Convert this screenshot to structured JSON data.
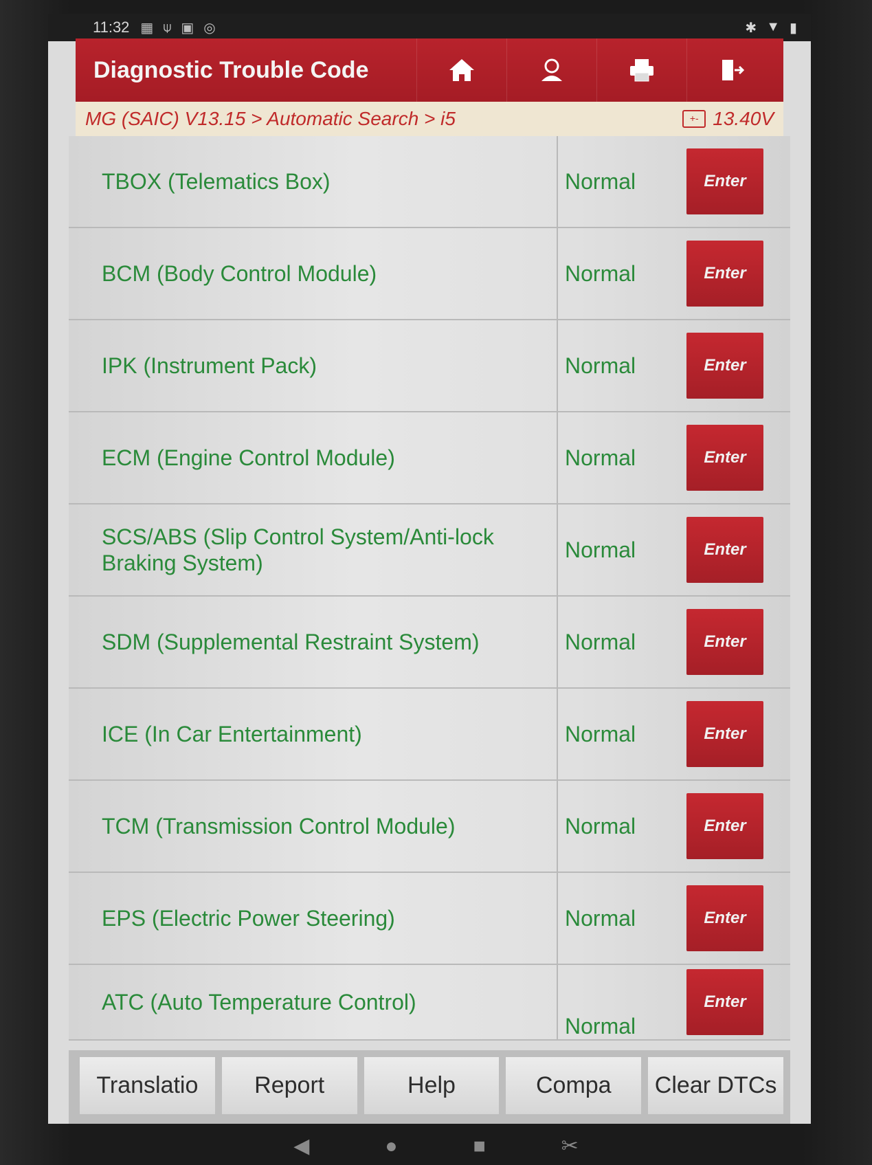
{
  "status_bar": {
    "time": "11:32",
    "icons": [
      "notification-icon",
      "usb-icon",
      "image-icon",
      "sync-icon"
    ],
    "right_icons": [
      "bluetooth-icon",
      "wifi-icon",
      "battery-icon"
    ]
  },
  "header": {
    "title": "Diagnostic Trouble Code",
    "buttons": [
      "home-icon",
      "user-icon",
      "print-icon",
      "exit-icon"
    ]
  },
  "breadcrumb": {
    "path": "MG (SAIC) V13.15 > Automatic Search > i5",
    "voltage": "13.40V"
  },
  "modules": [
    {
      "name": "TBOX (Telematics Box)",
      "status": "Normal",
      "action": "Enter"
    },
    {
      "name": "BCM (Body Control Module)",
      "status": "Normal",
      "action": "Enter"
    },
    {
      "name": "IPK (Instrument Pack)",
      "status": "Normal",
      "action": "Enter"
    },
    {
      "name": "ECM (Engine Control Module)",
      "status": "Normal",
      "action": "Enter"
    },
    {
      "name": "SCS/ABS (Slip Control System/Anti-lock Braking System)",
      "status": "Normal",
      "action": "Enter"
    },
    {
      "name": "SDM (Supplemental Restraint System)",
      "status": "Normal",
      "action": "Enter"
    },
    {
      "name": "ICE (In Car Entertainment)",
      "status": "Normal",
      "action": "Enter"
    },
    {
      "name": "TCM (Transmission Control Module)",
      "status": "Normal",
      "action": "Enter"
    },
    {
      "name": "EPS (Electric Power Steering)",
      "status": "Normal",
      "action": "Enter"
    },
    {
      "name": "ATC (Auto Temperature Control)",
      "status": "Normal",
      "action": "Enter"
    }
  ],
  "bottom_bar": [
    "Translatio",
    "Report",
    "Help",
    "Compa",
    "Clear DTCs"
  ],
  "colors": {
    "header_red": "#b8232c",
    "text_green": "#2a8a3a",
    "crumb_red": "#c02a2a"
  }
}
